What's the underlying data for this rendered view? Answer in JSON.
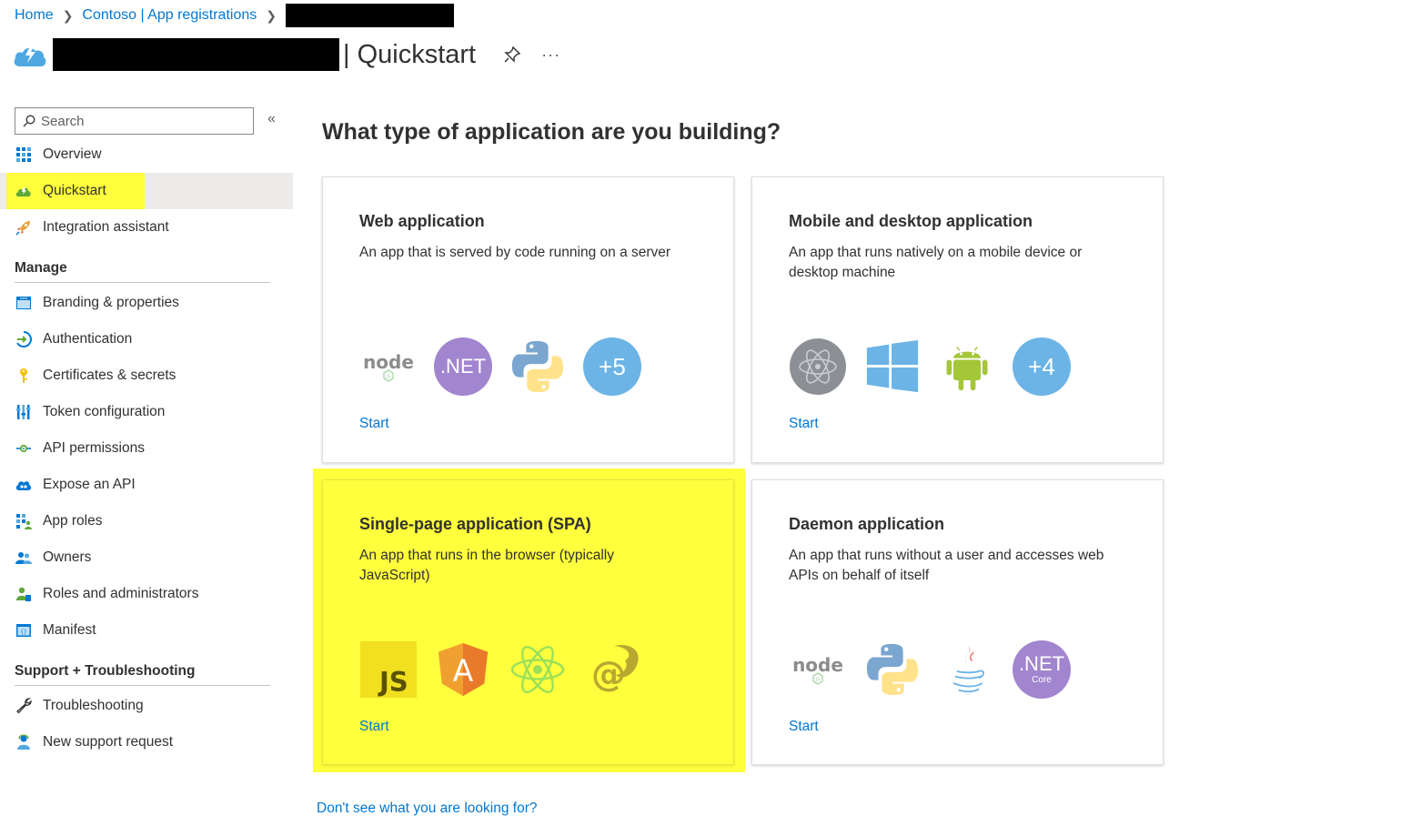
{
  "breadcrumb": {
    "home": "Home",
    "app_registrations": "Contoso | App registrations"
  },
  "header": {
    "title_suffix": "| Quickstart",
    "more": "···"
  },
  "sidebar": {
    "search_placeholder": "Search",
    "collapse": "«",
    "top_items": [
      {
        "label": "Overview",
        "icon": "overview-icon"
      },
      {
        "label": "Quickstart",
        "icon": "quickstart-icon"
      },
      {
        "label": "Integration assistant",
        "icon": "rocket-icon"
      }
    ],
    "manage_heading": "Manage",
    "manage_items": [
      {
        "label": "Branding & properties",
        "icon": "branding-icon"
      },
      {
        "label": "Authentication",
        "icon": "authentication-icon"
      },
      {
        "label": "Certificates & secrets",
        "icon": "key-icon"
      },
      {
        "label": "Token configuration",
        "icon": "token-icon"
      },
      {
        "label": "API permissions",
        "icon": "api-permissions-icon"
      },
      {
        "label": "Expose an API",
        "icon": "expose-api-icon"
      },
      {
        "label": "App roles",
        "icon": "app-roles-icon"
      },
      {
        "label": "Owners",
        "icon": "owners-icon"
      },
      {
        "label": "Roles and administrators",
        "icon": "roles-icon"
      },
      {
        "label": "Manifest",
        "icon": "manifest-icon"
      }
    ],
    "support_heading": "Support + Troubleshooting",
    "support_items": [
      {
        "label": "Troubleshooting",
        "icon": "wrench-icon"
      },
      {
        "label": "New support request",
        "icon": "support-person-icon"
      }
    ]
  },
  "main": {
    "heading": "What type of application are you building?",
    "cards": [
      {
        "title": "Web application",
        "description": "An app that is served by code running on a server",
        "start": "Start",
        "more_badge": "+5",
        "net_badge": ".NET"
      },
      {
        "title": "Mobile and desktop application",
        "description": "An app that runs natively on a mobile device or desktop machine",
        "start": "Start",
        "more_badge": "+4"
      },
      {
        "title": "Single-page application (SPA)",
        "description": "An app that runs in the browser (typically JavaScript)",
        "start": "Start",
        "js_badge": "JS",
        "angular_badge": "A"
      },
      {
        "title": "Daemon application",
        "description": "An app that runs without a user and accesses web APIs on behalf of itself",
        "start": "Start",
        "net_badge": ".NET",
        "net_sub": "Core"
      }
    ],
    "footer_link": "Don't see what you are looking for?"
  },
  "colors": {
    "accent": "#0078d4",
    "highlight": "#ffff3d",
    "net_purple": "#a285cf",
    "badge_blue": "#6cb4e6"
  }
}
